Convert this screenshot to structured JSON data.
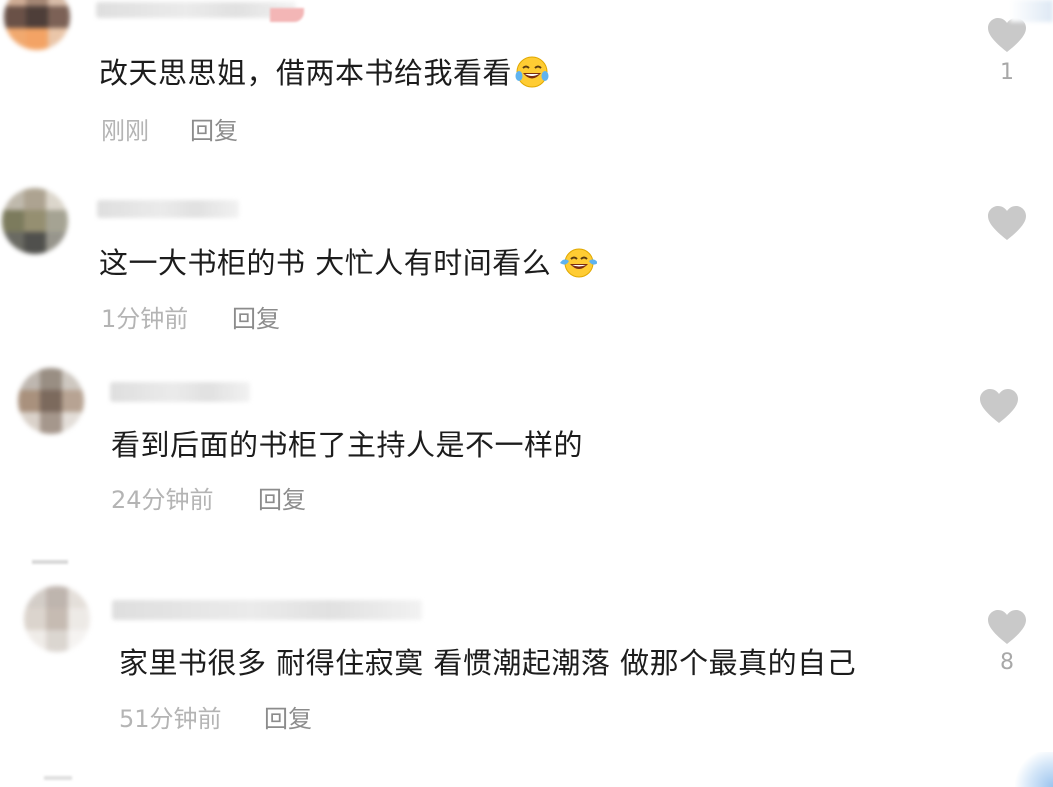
{
  "comments": [
    {
      "text": "改天思思姐，借两本书给我看看",
      "emoji": "laughing-crying-emoji",
      "time": "刚刚",
      "reply_label": "回复",
      "likes": "1"
    },
    {
      "text": "这一大书柜的书 大忙人有时间看么",
      "emoji": "tears-of-joy-emoji",
      "time": "1分钟前",
      "reply_label": "回复",
      "likes": ""
    },
    {
      "text": "看到后面的书柜了主持人是不一样的",
      "emoji": "",
      "time": "24分钟前",
      "reply_label": "回复",
      "likes": ""
    },
    {
      "text": "家里书很多 耐得住寂寞 看惯潮起潮落 做那个最真的自己",
      "emoji": "",
      "time": "51分钟前",
      "reply_label": "回复",
      "likes": "8"
    }
  ],
  "icons": {
    "like": "heart-icon"
  },
  "colors": {
    "text": "#1c1c1c",
    "meta": "#b4b4b4",
    "reply": "#8c8c8c",
    "heart": "#c9c9c9"
  }
}
